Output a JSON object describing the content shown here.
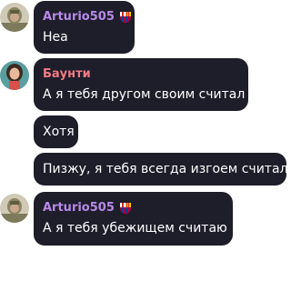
{
  "messages": [
    {
      "sender": "Arturio505",
      "sender_color": "#b78ae8",
      "sender_badge": "fc-barcelona-crest-icon",
      "text": "Неа",
      "avatar": "soldier-avatar"
    },
    {
      "sender": "Баунти",
      "sender_color": "#f07b84",
      "text": "А я тебя другом своим считал",
      "avatar": "girl-avatar"
    },
    {
      "text": "Хотя"
    },
    {
      "text": "Пизжу, я тебя всегда изгоем считал"
    },
    {
      "sender": "Arturio505",
      "sender_color": "#b78ae8",
      "sender_badge": "fc-barcelona-crest-icon",
      "text": "А я тебя убежищем считаю",
      "avatar": "soldier-avatar"
    }
  ],
  "colors": {
    "bubble_bg": "#1e1d2a",
    "page_bg": "#ffffff",
    "text": "#ffffff"
  }
}
